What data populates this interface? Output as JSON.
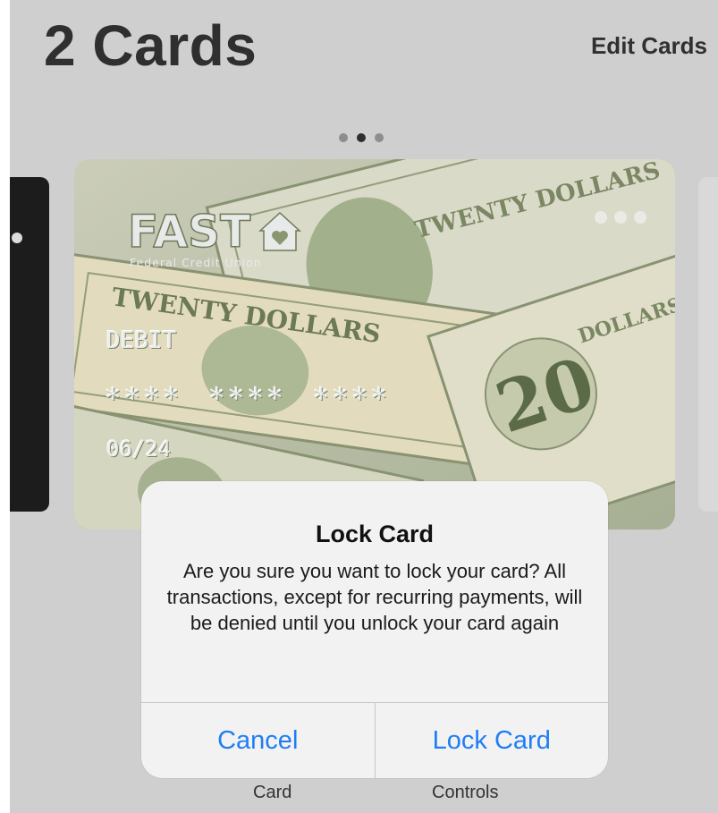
{
  "header": {
    "title": "2 Cards",
    "edit_label": "Edit Cards"
  },
  "pager": {
    "total": 3,
    "active_index": 1
  },
  "card": {
    "brand": "FAST",
    "brand_subtitle": "Federal Credit Union",
    "type": "DEBIT",
    "number_masked": "**** **** ****",
    "expiry": "06/24",
    "background_theme": "twenty-dollar-bills",
    "denomination_text": "20",
    "bill_text": "TWENTY DOLLARS",
    "menu_icon": "more-dots-icon"
  },
  "alert": {
    "title": "Lock Card",
    "message": "Are you sure you want to lock your card? All transactions, except for recurring payments, will be denied until you unlock your card again",
    "cancel_label": "Cancel",
    "confirm_label": "Lock Card"
  },
  "bottom_tabs": {
    "card_label": "Card",
    "controls_label": "Controls"
  },
  "colors": {
    "background": "#cfcfcf",
    "alert_background": "#f2f2f2",
    "action_blue": "#1f7ef5",
    "title_text": "#2f2f2f"
  }
}
